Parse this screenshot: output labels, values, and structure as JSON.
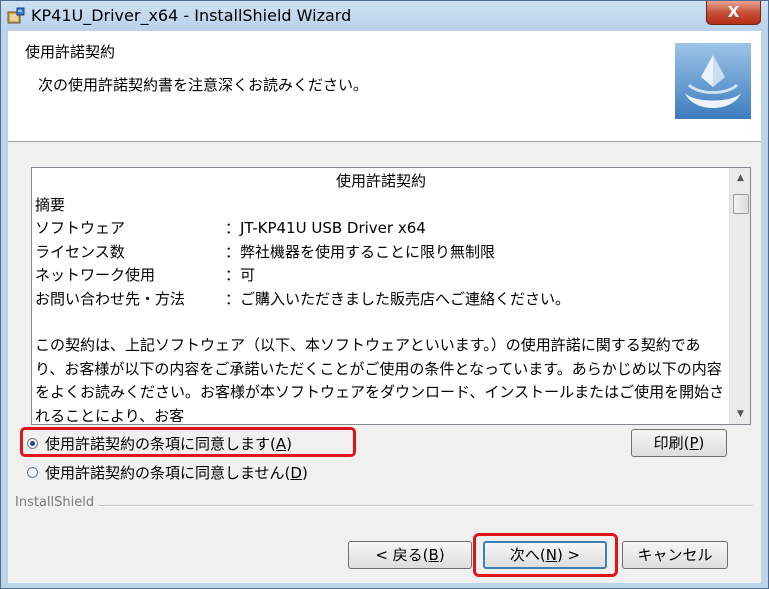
{
  "window": {
    "title": "KP41U_Driver_x64 - InstallShield Wizard",
    "close_label": "X"
  },
  "header": {
    "title": "使用許諾契約",
    "subtitle": "次の使用許諾契約書を注意深くお読みください。"
  },
  "license": {
    "heading": "使用許諾契約",
    "summary_label": "摘要",
    "rows": [
      {
        "key": "ソフトウェア",
        "value": "：JT-KP41U USB Driver x64"
      },
      {
        "key": "ライセンス数",
        "value": "：弊社機器を使用することに限り無制限"
      },
      {
        "key": "ネットワーク使用",
        "value": "：可"
      },
      {
        "key": "お問い合わせ先・方法",
        "value": "：ご購入いただきました販売店へご連絡ください。"
      }
    ],
    "paragraph": "この契約は、上記ソフトウェア（以下、本ソフトウェアといいます。）の使用許諾に関する契約であり、お客様が以下の内容をご承諾いただくことがご使用の条件となっています。あらかじめ以下の内容をよくお読みください。お客様が本ソフトウェアをダウンロード、インストールまたはご使用を開始されることにより、お客"
  },
  "options": {
    "agree_label": "使用許諾契約の条項に同意します(",
    "agree_key": "A",
    "disagree_label": "使用許諾契約の条項に同意しません(",
    "disagree_key": "D",
    "selected": "agree"
  },
  "buttons": {
    "print_label": "印刷(",
    "print_key": "P",
    "back_label": "< 戻る(",
    "back_key": "B",
    "next_label": "次へ(",
    "next_key": "N",
    "next_suffix": ") >",
    "cancel_label": "キャンセル"
  },
  "brand": "InstallShield",
  "colors": {
    "highlight": "#e0151b",
    "title_bar": "#b9d1ea",
    "close_button": "#c6503a"
  }
}
